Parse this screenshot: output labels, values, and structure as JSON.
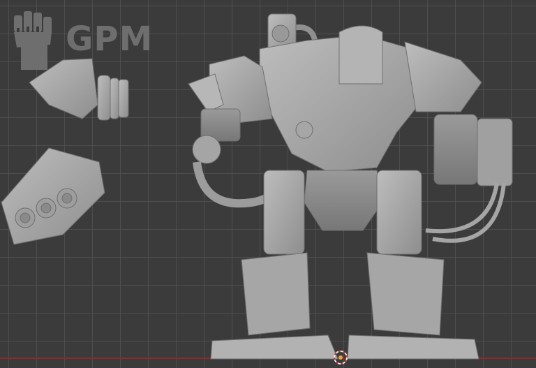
{
  "viewport": {
    "logo_text": "GPM",
    "colors": {
      "background": "#3b3b3b",
      "grid": "#505050",
      "model": "#a8a8a8",
      "x_axis": "#8c2a2a",
      "origin": "#e8e8e8"
    },
    "icons": {
      "logo": "raised-fist-icon",
      "origin": "3d-cursor-icon"
    }
  }
}
